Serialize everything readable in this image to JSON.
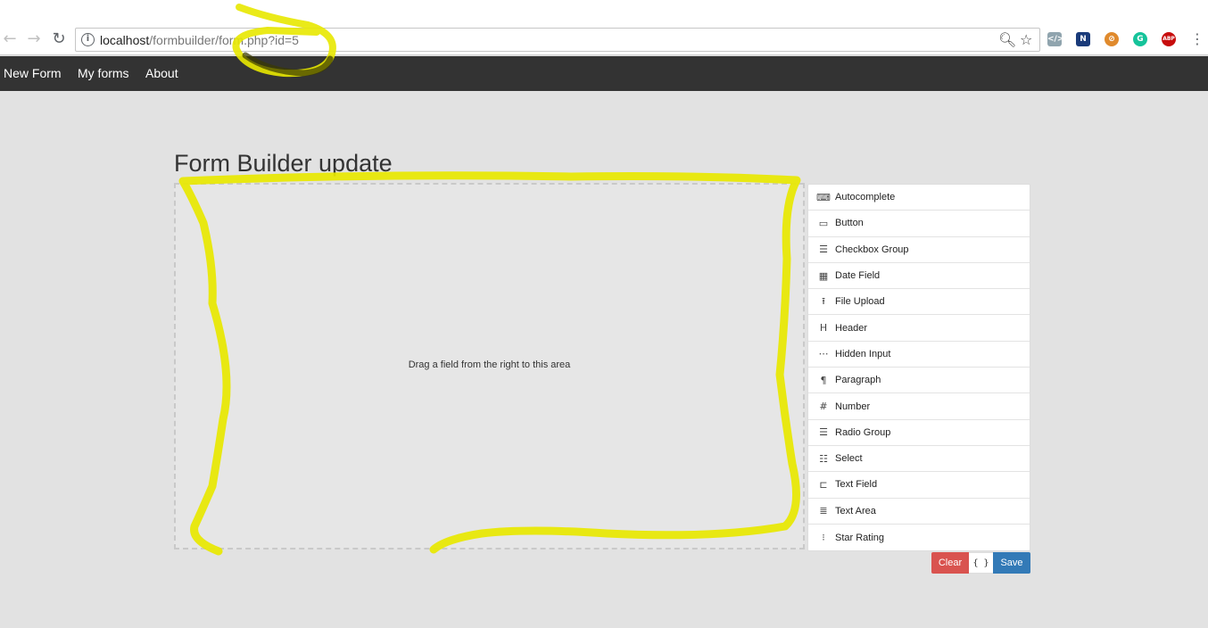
{
  "browser": {
    "url_host": "localhost",
    "url_path": "/formbuilder/form.php?id=5",
    "extensions": [
      {
        "name": "code-extension-icon",
        "label": "</>",
        "color": "#90a4ae"
      },
      {
        "name": "n-extension-icon",
        "label": "N",
        "color": "#1a3b7a"
      },
      {
        "name": "bike-extension-icon",
        "label": "⊘",
        "color": "#e08a2d"
      },
      {
        "name": "grammarly-icon",
        "label": "G",
        "color": "#15c39a"
      },
      {
        "name": "adblock-icon",
        "label": "ABP",
        "color": "#c70d0d"
      }
    ]
  },
  "navbar": {
    "items": [
      "New Form",
      "My forms",
      "About"
    ]
  },
  "page": {
    "title": "Form Builder update",
    "stage_hint": "Drag a field from the right to this area"
  },
  "controls": [
    {
      "label": "Autocomplete",
      "icon": "autocomplete-icon",
      "glyph": "⌨"
    },
    {
      "label": "Button",
      "icon": "button-icon",
      "glyph": "▭"
    },
    {
      "label": "Checkbox Group",
      "icon": "checkbox-group-icon",
      "glyph": "☰"
    },
    {
      "label": "Date Field",
      "icon": "calendar-icon",
      "glyph": "▦"
    },
    {
      "label": "File Upload",
      "icon": "upload-icon",
      "glyph": "⭱"
    },
    {
      "label": "Header",
      "icon": "header-icon",
      "glyph": "H"
    },
    {
      "label": "Hidden Input",
      "icon": "hidden-input-icon",
      "glyph": "⋯"
    },
    {
      "label": "Paragraph",
      "icon": "paragraph-icon",
      "glyph": "¶"
    },
    {
      "label": "Number",
      "icon": "number-icon",
      "glyph": "#"
    },
    {
      "label": "Radio Group",
      "icon": "radio-group-icon",
      "glyph": "☰"
    },
    {
      "label": "Select",
      "icon": "select-icon",
      "glyph": "☷"
    },
    {
      "label": "Text Field",
      "icon": "text-field-icon",
      "glyph": "⊏"
    },
    {
      "label": "Text Area",
      "icon": "text-area-icon",
      "glyph": "≣"
    },
    {
      "label": "Star Rating",
      "icon": "star-rating-icon",
      "glyph": "⁝"
    }
  ],
  "actions": {
    "clear": "Clear",
    "data": "{ }",
    "save": "Save"
  },
  "colors": {
    "navbar": "#333333",
    "highlighter": "#e8e800",
    "clear": "#d9534f",
    "save": "#337ab7"
  }
}
